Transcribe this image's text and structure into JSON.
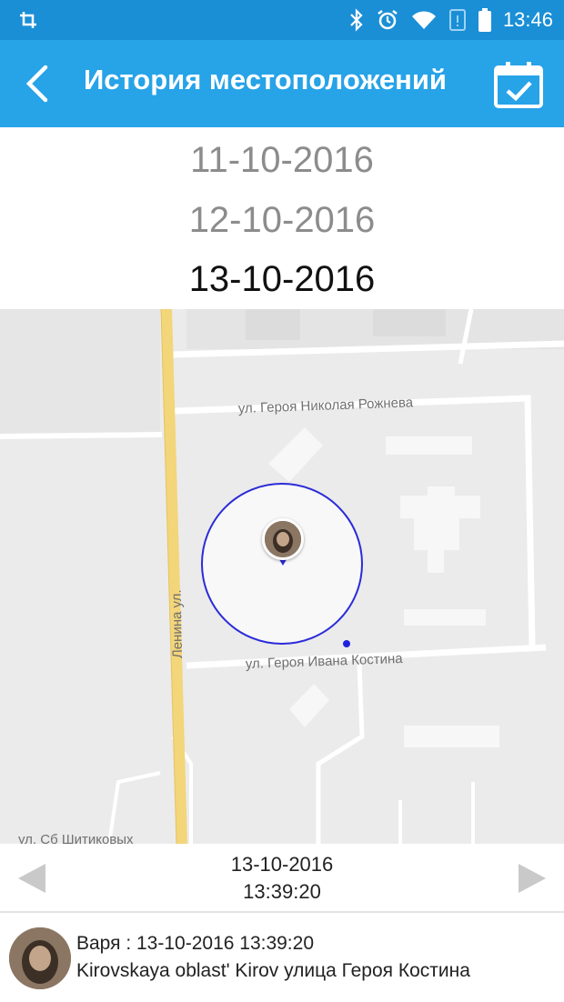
{
  "status_bar": {
    "time": "13:46",
    "icons": [
      "screen-rotate-icon",
      "bluetooth-icon",
      "alarm-icon",
      "wifi-icon",
      "no-sim-icon",
      "battery-icon"
    ]
  },
  "app_bar": {
    "title": "История местоположений",
    "back_icon": "chevron-left-icon",
    "calendar_icon": "calendar-check-icon",
    "color": "#27a3e8"
  },
  "date_picker": {
    "dates": [
      "11-10-2016",
      "12-10-2016",
      "13-10-2016"
    ],
    "selected": "13-10-2016"
  },
  "map": {
    "streets": [
      "ул. Героя Николая Рожнева",
      "ул. Героя Ивана Костина",
      "Ленина ул.",
      "ул. Сб Шитиковых"
    ],
    "accuracy_circle_color": "#2b2bd9",
    "road_color": "#f3d57a"
  },
  "nav": {
    "date": "13-10-2016",
    "time": "13:39:20",
    "prev_icon": "triangle-left-icon",
    "next_icon": "triangle-right-icon"
  },
  "info": {
    "line1": "Варя : 13-10-2016 13:39:20",
    "line2": "Kirovskaya oblast' Kirov улица Героя Костина"
  }
}
